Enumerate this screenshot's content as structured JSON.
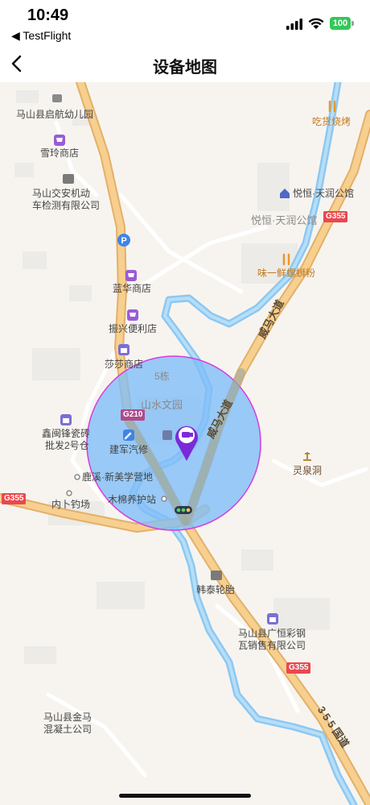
{
  "status_bar": {
    "time": "10:49",
    "back_app": "◀ TestFlight",
    "battery": "100"
  },
  "header": {
    "title": "设备地图"
  },
  "map": {
    "pois": [
      {
        "id": "kindergarten",
        "label": "马山县启航幼儿园"
      },
      {
        "id": "xueling",
        "label": "雪玲商店"
      },
      {
        "id": "vehicle-test-1",
        "label": "马山交安机动"
      },
      {
        "id": "vehicle-test-2",
        "label": "车检测有限公司"
      },
      {
        "id": "lanhua",
        "label": "蓝华商店"
      },
      {
        "id": "zhenxing",
        "label": "振兴便利店"
      },
      {
        "id": "shasha",
        "label": "莎莎商店"
      },
      {
        "id": "xinchuang-1",
        "label": "鑫闽锋瓷砖"
      },
      {
        "id": "xinchuang-2",
        "label": "批发2号仓"
      },
      {
        "id": "jianjun",
        "label": "建军汽修"
      },
      {
        "id": "luxi",
        "label": "鹿溪·新美学营地"
      },
      {
        "id": "neibu",
        "label": "内卜钓场"
      },
      {
        "id": "mumian",
        "label": "木棉养护站"
      },
      {
        "id": "shanshui",
        "label": "山水文园"
      },
      {
        "id": "building5",
        "label": "5栋"
      },
      {
        "id": "chihuo",
        "label": "吃货烧烤"
      },
      {
        "id": "yueheng-hotel",
        "label": "悦恒·天润公馆"
      },
      {
        "id": "yueheng-area",
        "label": "悦恒·天润公馆"
      },
      {
        "id": "weiyi",
        "label": "味一鲜螺蛳粉"
      },
      {
        "id": "lingquan",
        "label": "灵泉洞"
      },
      {
        "id": "hantai",
        "label": "韩泰轮胎"
      },
      {
        "id": "guangheng-1",
        "label": "马山县广恒彩钢"
      },
      {
        "id": "guangheng-2",
        "label": "瓦销售有限公司"
      },
      {
        "id": "jinma-1",
        "label": "马山县金马"
      },
      {
        "id": "jinma-2",
        "label": "混凝土公司"
      }
    ],
    "roads": {
      "weima_upper": "威马大道",
      "weima_lower": "威马大道",
      "guodao_355": "3 5 5 国道"
    },
    "shields": {
      "g210": "G210",
      "g355_left": "G355",
      "g355_right": "G355",
      "g355_bottom": "G355"
    },
    "geofence": {
      "fill": "#7fbcf7",
      "stroke": "#d63adf"
    },
    "colors": {
      "road_major": "#f2c27a",
      "road_minor": "#ffffff",
      "river": "#8cc8f2",
      "background": "#f7f4ef"
    }
  }
}
